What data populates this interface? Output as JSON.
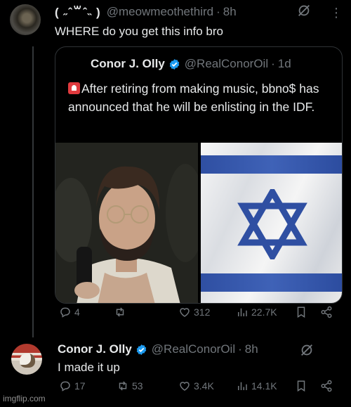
{
  "reply_1": {
    "display_name": "( ˶ˆ꒳ˆ˵ )",
    "handle": "@meowmeothethird",
    "separator": "·",
    "time": "8h",
    "text": "WHERE do you get this info bro"
  },
  "quoted_post": {
    "display_name": "Conor J. Olly",
    "handle": "@RealConorOil",
    "separator": "·",
    "time": "1d",
    "text": "After retiring from making music, bbno$ has announced that he will be enlisting in the IDF.",
    "media": [
      "person-photo",
      "israel-flag"
    ]
  },
  "actions_1": {
    "replies": "4",
    "reposts": "",
    "likes": "312",
    "views": "22.7K"
  },
  "reply_2": {
    "display_name": "Conor J. Olly",
    "handle": "@RealConorOil",
    "separator": "·",
    "time": "8h",
    "text": "I made it up"
  },
  "actions_2": {
    "replies": "17",
    "reposts": "53",
    "likes": "3.4K",
    "views": "14.1K"
  },
  "watermark": "imgflip.com",
  "colors": {
    "background": "#000000",
    "text": "#e7e9ea",
    "muted": "#71767b",
    "verified": "#1d9bf0",
    "border": "#2f3336"
  }
}
